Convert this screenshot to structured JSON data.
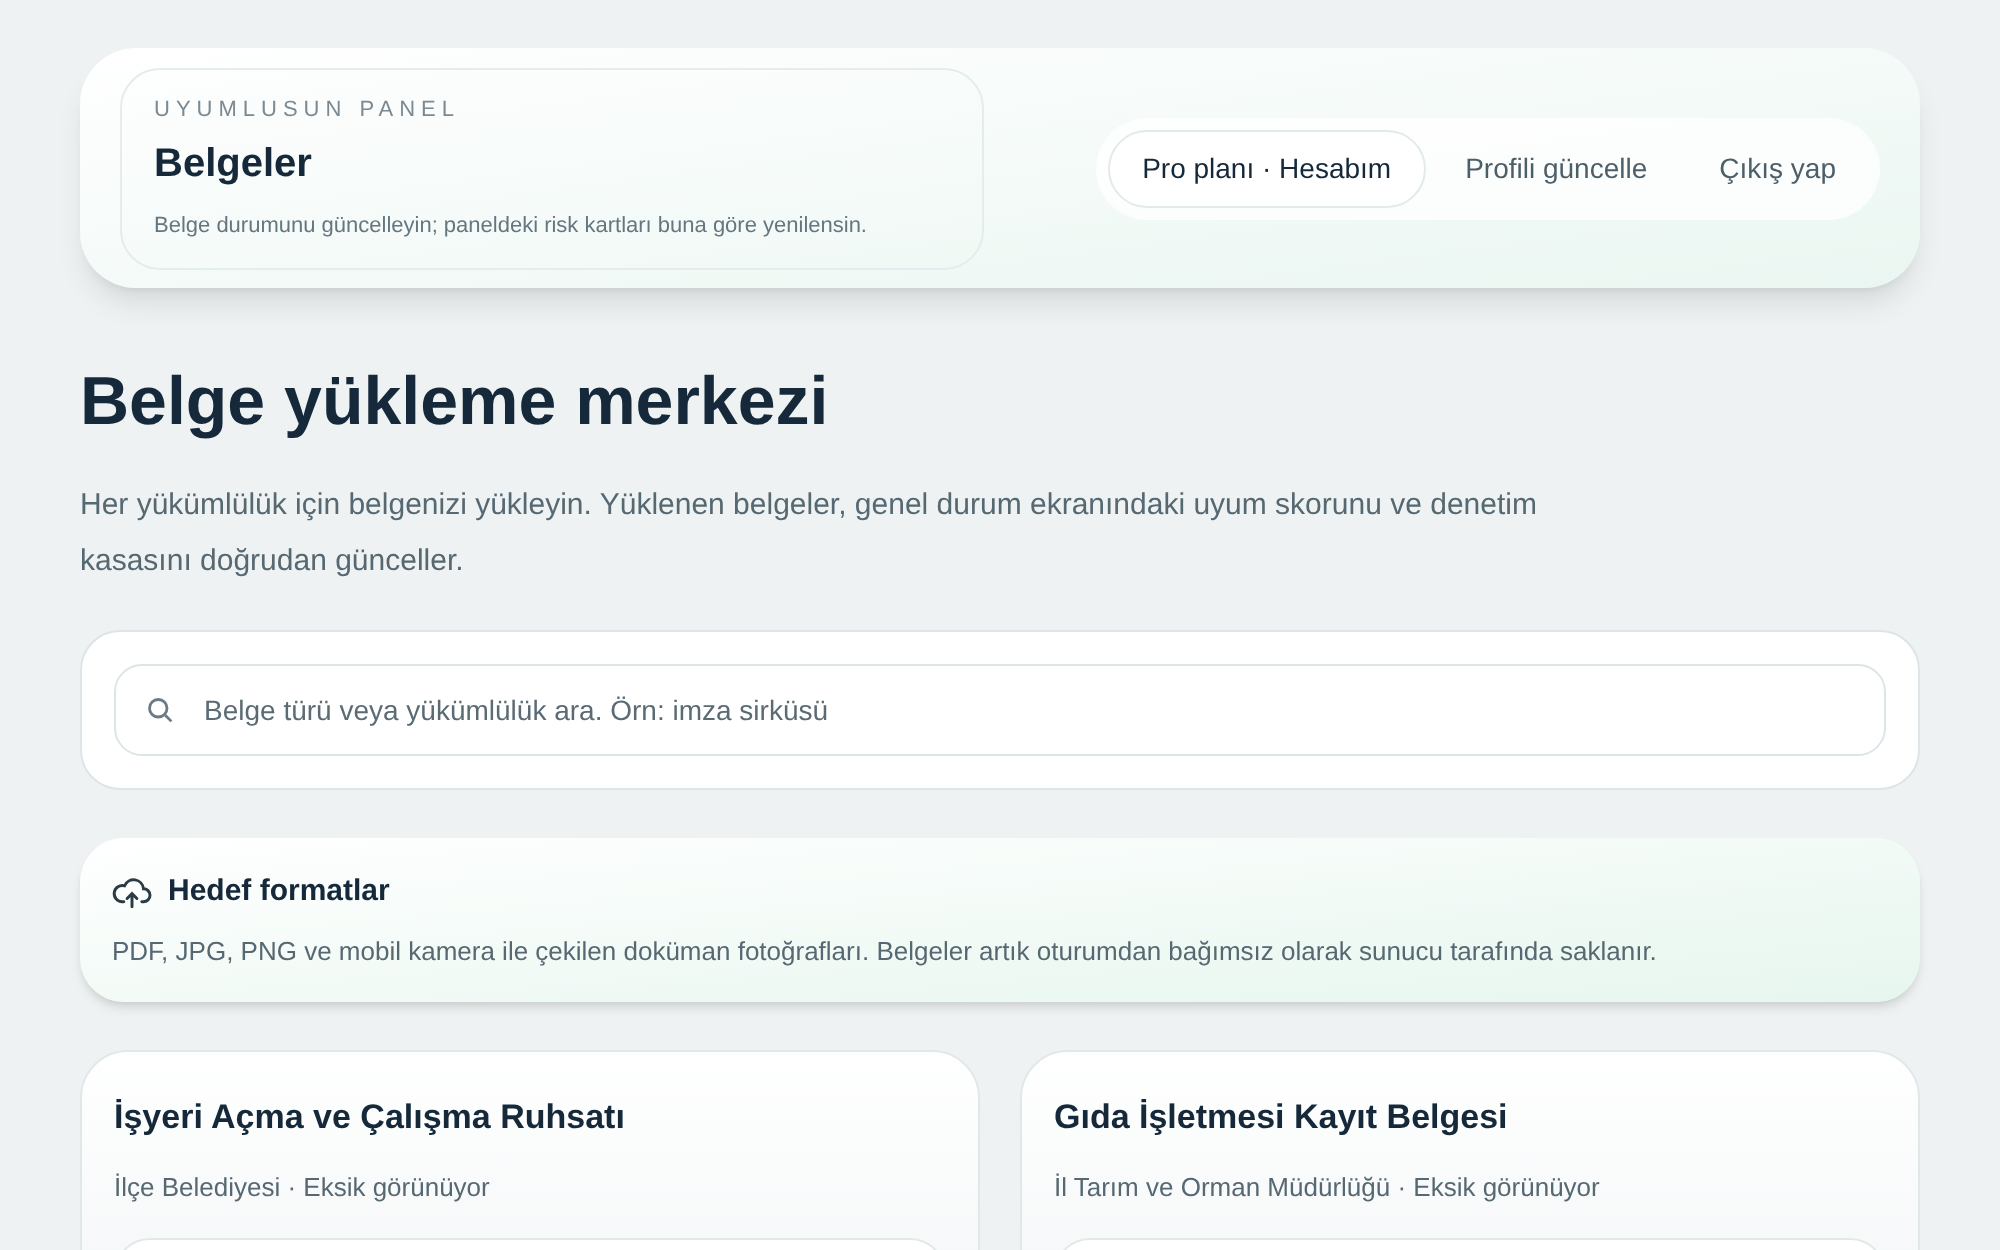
{
  "header": {
    "eyebrow": "UYUMLUSUN PANEL",
    "title": "Belgeler",
    "subtitle": "Belge durumunu güncelleyin; paneldeki risk kartları buna göre yenilensin.",
    "nav": [
      {
        "label": "Pro planı · Hesabım",
        "selected": true
      },
      {
        "label": "Profili güncelle",
        "selected": false
      },
      {
        "label": "Çıkış yap",
        "selected": false
      }
    ]
  },
  "page": {
    "title": "Belge yükleme merkezi",
    "description": "Her yükümlülük için belgenizi yükleyin. Yüklenen belgeler, genel durum ekranındaki uyum skorunu ve denetim kasasını doğrudan günceller."
  },
  "search": {
    "placeholder": "Belge türü veya yükümlülük ara. Örn: imza sirküsü"
  },
  "formats": {
    "title": "Hedef formatlar",
    "text": "PDF, JPG, PNG ve mobil kamera ile çekilen doküman fotoğrafları. Belgeler artık oturumdan bağımsız olarak sunucu tarafında saklanır."
  },
  "documents": [
    {
      "title": "İşyeri Açma ve Çalışma Ruhsatı",
      "meta": "İlçe Belediyesi · Eksik görünüyor"
    },
    {
      "title": "Gıda İşletmesi Kayıt Belgesi",
      "meta": "İl Tarım ve Orman Müdürlüğü · Eksik görünüyor"
    }
  ]
}
